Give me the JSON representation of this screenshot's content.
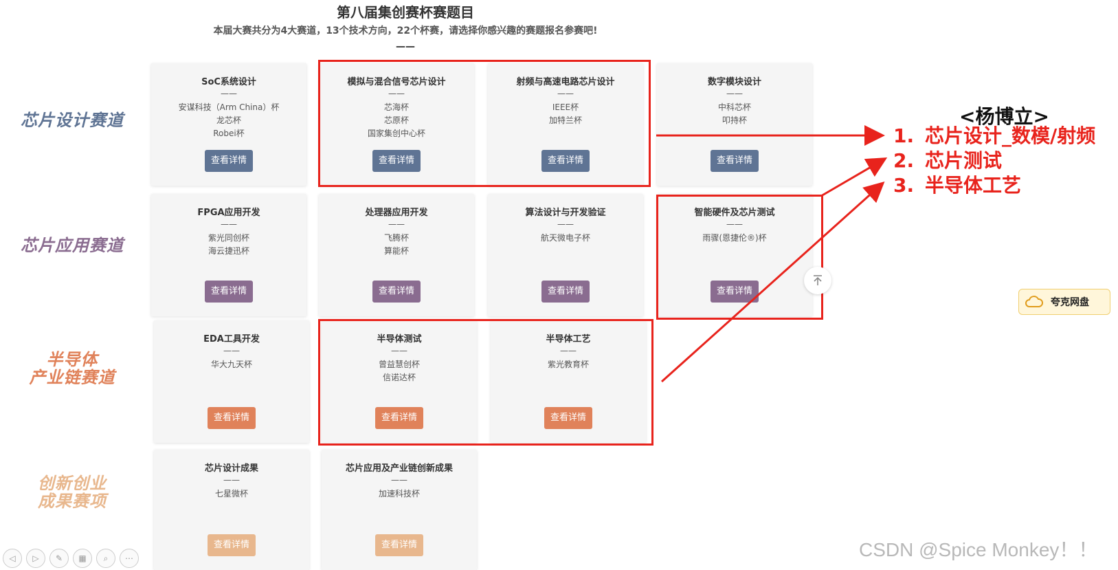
{
  "header": {
    "title": "第八届集创赛杯赛题目",
    "subtitle": "本届大赛共分为4大赛道，13个技术方向，22个杯赛，请选择你感兴趣的赛题报名参赛吧!",
    "dash": "——"
  },
  "tracks": [
    {
      "label": "芯片设计赛道",
      "color": "#5f7494"
    },
    {
      "label": "芯片应用赛道",
      "color": "#8a6c90"
    },
    {
      "label": "半导体\n产业链赛道",
      "color": "#e0825a"
    },
    {
      "label": "创新创业\n成果赛项",
      "color": "#e8b78d"
    }
  ],
  "card_dash": "——",
  "button_label": "查看详情",
  "cards": [
    {
      "title": "SoC系统设计",
      "cups": [
        "安谋科技（Arm China）杯",
        "龙芯杯",
        "Robei杯"
      ],
      "button_color": "#5f7494"
    },
    {
      "title": "模拟与混合信号芯片设计",
      "cups": [
        "芯海杯",
        "芯原杯",
        "国家集创中心杯"
      ],
      "button_color": "#5f7494"
    },
    {
      "title": "射频与高速电路芯片设计",
      "cups": [
        "IEEE杯",
        "加特兰杯"
      ],
      "button_color": "#5f7494"
    },
    {
      "title": "数字模块设计",
      "cups": [
        "中科芯杯",
        "叩持杯"
      ],
      "button_color": "#5f7494"
    },
    {
      "title": "FPGA应用开发",
      "cups": [
        "紫光同创杯",
        "海云捷迅杯"
      ],
      "button_color": "#8a6c90"
    },
    {
      "title": "处理器应用开发",
      "cups": [
        "飞腾杯",
        "算能杯"
      ],
      "button_color": "#8a6c90"
    },
    {
      "title": "算法设计与开发验证",
      "cups": [
        "航天微电子杯"
      ],
      "button_color": "#8a6c90"
    },
    {
      "title": "智能硬件及芯片测试",
      "cups": [
        "雨骤(恩捷伦®)杯"
      ],
      "button_color": "#8a6c90"
    },
    {
      "title": "EDA工具开发",
      "cups": [
        "华大九天杯"
      ],
      "button_color": "#e0825a"
    },
    {
      "title": "半导体测试",
      "cups": [
        "曾益慧创杯",
        "信诺达杯"
      ],
      "button_color": "#e0825a"
    },
    {
      "title": "半导体工艺",
      "cups": [
        "紫光教育杯"
      ],
      "button_color": "#e0825a"
    },
    {
      "title": "芯片设计成果",
      "cups": [
        "七星微杯"
      ],
      "button_color": "#e8b78d"
    },
    {
      "title": "芯片应用及产业链创新成果",
      "cups": [
        "加速科技杯"
      ],
      "button_color": "#e8b78d"
    }
  ],
  "annotation": {
    "name": "<杨博立>",
    "items": [
      {
        "num": "1.",
        "text": "芯片设计_数模/射频"
      },
      {
        "num": "2.",
        "text": "芯片测试"
      },
      {
        "num": "3.",
        "text": "半导体工艺"
      }
    ],
    "color": "#e8231c"
  },
  "quark": {
    "label": "夸克网盘",
    "icon": "cloud-icon"
  },
  "scroll_top_icon": "arrow-up-to-top-icon",
  "watermark": "CSDN @Spice Monkey！！"
}
